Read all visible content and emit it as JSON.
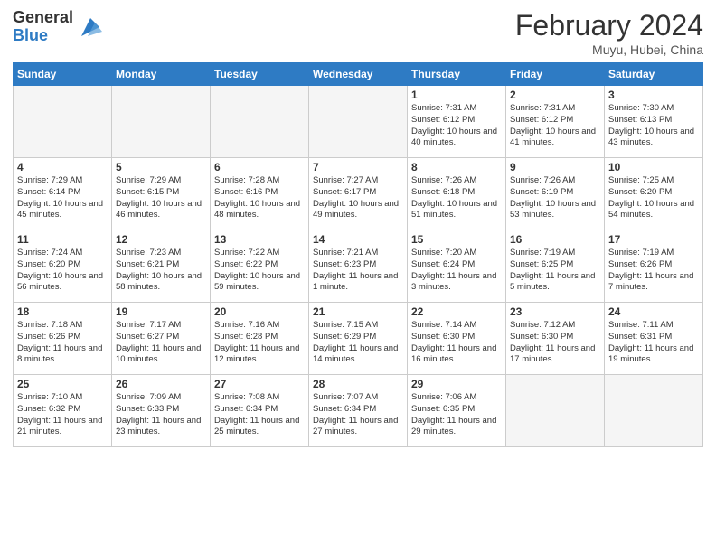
{
  "header": {
    "logo_general": "General",
    "logo_blue": "Blue",
    "month_year": "February 2024",
    "location": "Muyu, Hubei, China"
  },
  "days_of_week": [
    "Sunday",
    "Monday",
    "Tuesday",
    "Wednesday",
    "Thursday",
    "Friday",
    "Saturday"
  ],
  "weeks": [
    [
      {
        "day": "",
        "empty": true
      },
      {
        "day": "",
        "empty": true
      },
      {
        "day": "",
        "empty": true
      },
      {
        "day": "",
        "empty": true
      },
      {
        "day": "1",
        "sunrise": "7:31 AM",
        "sunset": "6:12 PM",
        "daylight": "10 hours and 40 minutes."
      },
      {
        "day": "2",
        "sunrise": "7:31 AM",
        "sunset": "6:12 PM",
        "daylight": "10 hours and 41 minutes."
      },
      {
        "day": "3",
        "sunrise": "7:30 AM",
        "sunset": "6:13 PM",
        "daylight": "10 hours and 43 minutes."
      }
    ],
    [
      {
        "day": "4",
        "sunrise": "7:29 AM",
        "sunset": "6:14 PM",
        "daylight": "10 hours and 45 minutes."
      },
      {
        "day": "5",
        "sunrise": "7:29 AM",
        "sunset": "6:15 PM",
        "daylight": "10 hours and 46 minutes."
      },
      {
        "day": "6",
        "sunrise": "7:28 AM",
        "sunset": "6:16 PM",
        "daylight": "10 hours and 48 minutes."
      },
      {
        "day": "7",
        "sunrise": "7:27 AM",
        "sunset": "6:17 PM",
        "daylight": "10 hours and 49 minutes."
      },
      {
        "day": "8",
        "sunrise": "7:26 AM",
        "sunset": "6:18 PM",
        "daylight": "10 hours and 51 minutes."
      },
      {
        "day": "9",
        "sunrise": "7:26 AM",
        "sunset": "6:19 PM",
        "daylight": "10 hours and 53 minutes."
      },
      {
        "day": "10",
        "sunrise": "7:25 AM",
        "sunset": "6:20 PM",
        "daylight": "10 hours and 54 minutes."
      }
    ],
    [
      {
        "day": "11",
        "sunrise": "7:24 AM",
        "sunset": "6:20 PM",
        "daylight": "10 hours and 56 minutes."
      },
      {
        "day": "12",
        "sunrise": "7:23 AM",
        "sunset": "6:21 PM",
        "daylight": "10 hours and 58 minutes."
      },
      {
        "day": "13",
        "sunrise": "7:22 AM",
        "sunset": "6:22 PM",
        "daylight": "10 hours and 59 minutes."
      },
      {
        "day": "14",
        "sunrise": "7:21 AM",
        "sunset": "6:23 PM",
        "daylight": "11 hours and 1 minute."
      },
      {
        "day": "15",
        "sunrise": "7:20 AM",
        "sunset": "6:24 PM",
        "daylight": "11 hours and 3 minutes."
      },
      {
        "day": "16",
        "sunrise": "7:19 AM",
        "sunset": "6:25 PM",
        "daylight": "11 hours and 5 minutes."
      },
      {
        "day": "17",
        "sunrise": "7:19 AM",
        "sunset": "6:26 PM",
        "daylight": "11 hours and 7 minutes."
      }
    ],
    [
      {
        "day": "18",
        "sunrise": "7:18 AM",
        "sunset": "6:26 PM",
        "daylight": "11 hours and 8 minutes."
      },
      {
        "day": "19",
        "sunrise": "7:17 AM",
        "sunset": "6:27 PM",
        "daylight": "11 hours and 10 minutes."
      },
      {
        "day": "20",
        "sunrise": "7:16 AM",
        "sunset": "6:28 PM",
        "daylight": "11 hours and 12 minutes."
      },
      {
        "day": "21",
        "sunrise": "7:15 AM",
        "sunset": "6:29 PM",
        "daylight": "11 hours and 14 minutes."
      },
      {
        "day": "22",
        "sunrise": "7:14 AM",
        "sunset": "6:30 PM",
        "daylight": "11 hours and 16 minutes."
      },
      {
        "day": "23",
        "sunrise": "7:12 AM",
        "sunset": "6:30 PM",
        "daylight": "11 hours and 17 minutes."
      },
      {
        "day": "24",
        "sunrise": "7:11 AM",
        "sunset": "6:31 PM",
        "daylight": "11 hours and 19 minutes."
      }
    ],
    [
      {
        "day": "25",
        "sunrise": "7:10 AM",
        "sunset": "6:32 PM",
        "daylight": "11 hours and 21 minutes."
      },
      {
        "day": "26",
        "sunrise": "7:09 AM",
        "sunset": "6:33 PM",
        "daylight": "11 hours and 23 minutes."
      },
      {
        "day": "27",
        "sunrise": "7:08 AM",
        "sunset": "6:34 PM",
        "daylight": "11 hours and 25 minutes."
      },
      {
        "day": "28",
        "sunrise": "7:07 AM",
        "sunset": "6:34 PM",
        "daylight": "11 hours and 27 minutes."
      },
      {
        "day": "29",
        "sunrise": "7:06 AM",
        "sunset": "6:35 PM",
        "daylight": "11 hours and 29 minutes."
      },
      {
        "day": "",
        "empty": true
      },
      {
        "day": "",
        "empty": true
      }
    ]
  ]
}
